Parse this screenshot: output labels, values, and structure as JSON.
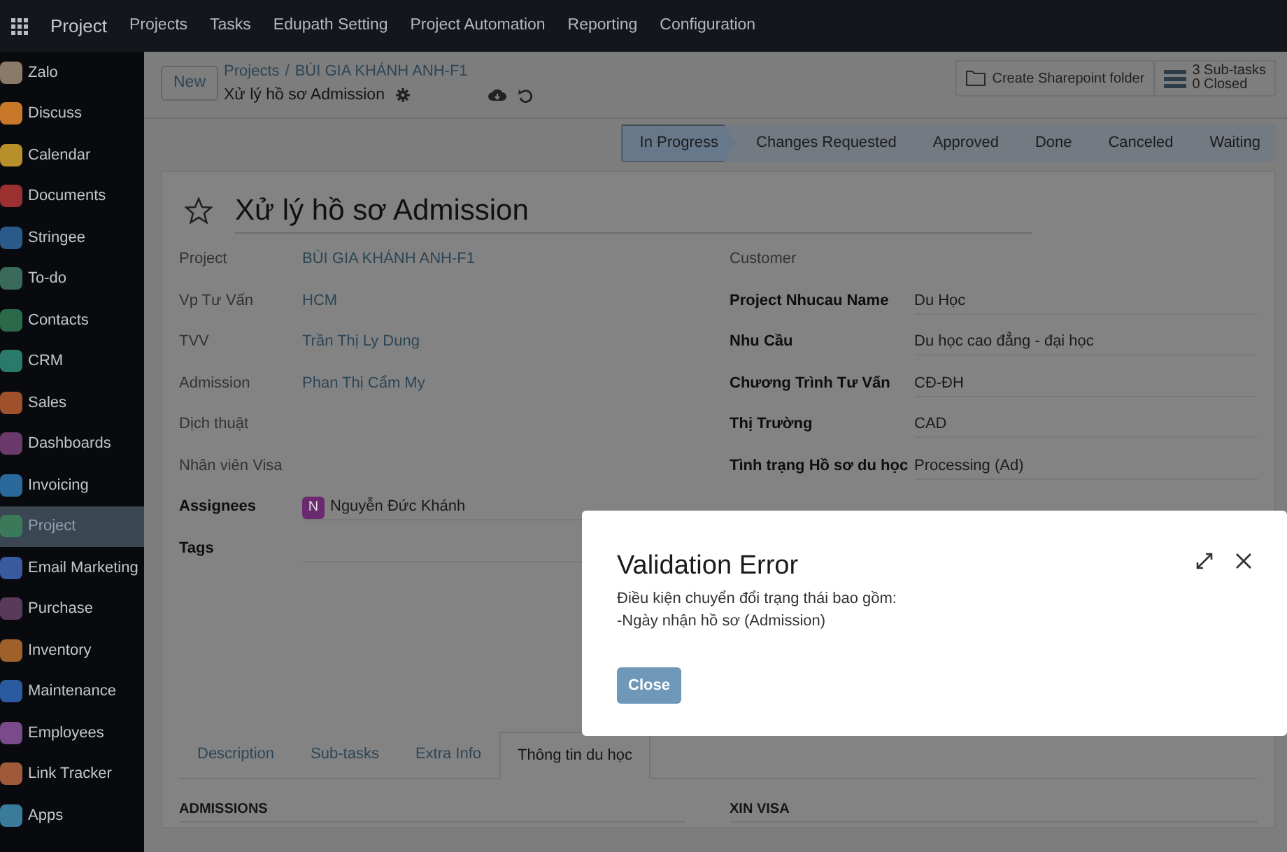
{
  "app_menu": {
    "brand": "Project",
    "items": [
      "Projects",
      "Tasks",
      "Edupath Setting",
      "Project Automation",
      "Reporting",
      "Configuration"
    ]
  },
  "sidebar": {
    "items": [
      {
        "label": "Zalo",
        "selected": false,
        "color": "#8a7a6a"
      },
      {
        "label": "Discuss",
        "selected": false,
        "color": "#c9782a"
      },
      {
        "label": "Calendar",
        "selected": false,
        "color": "#b8902a"
      },
      {
        "label": "Documents",
        "selected": false,
        "color": "#9a3030"
      },
      {
        "label": "Stringee",
        "selected": false,
        "color": "#2a5a8a"
      },
      {
        "label": "To-do",
        "selected": false,
        "color": "#3a6a5a"
      },
      {
        "label": "Contacts",
        "selected": false,
        "color": "#2a6a4a"
      },
      {
        "label": "CRM",
        "selected": false,
        "color": "#2a7a6a"
      },
      {
        "label": "Sales",
        "selected": false,
        "color": "#a0502a"
      },
      {
        "label": "Dashboards",
        "selected": false,
        "color": "#6a3a6a"
      },
      {
        "label": "Invoicing",
        "selected": false,
        "color": "#2a6a9a"
      },
      {
        "label": "Project",
        "selected": true,
        "color": "#3a7a5a"
      },
      {
        "label": "Email Marketing",
        "selected": false,
        "color": "#3a5aa0"
      },
      {
        "label": "Purchase",
        "selected": false,
        "color": "#5a3a5a"
      },
      {
        "label": "Inventory",
        "selected": false,
        "color": "#a0602a"
      },
      {
        "label": "Maintenance",
        "selected": false,
        "color": "#2a5aa0"
      },
      {
        "label": "Employees",
        "selected": false,
        "color": "#7a4a8a"
      },
      {
        "label": "Link Tracker",
        "selected": false,
        "color": "#a05a3a"
      },
      {
        "label": "Apps",
        "selected": false,
        "color": "#3a7a9a"
      }
    ]
  },
  "control_panel": {
    "new_button": "New",
    "breadcrumb": [
      "Projects",
      "BÙI GIA KHÁNH ANH-F1"
    ],
    "breadcrumb_separator": "/",
    "record_name": "Xử lý hồ sơ Admission",
    "sharepoint_button": "Create Sharepoint folder",
    "subtasks": {
      "count": "3 Sub-tasks",
      "closed": "0 Closed"
    }
  },
  "stages": [
    {
      "label": "In Progress",
      "selected": true
    },
    {
      "label": "Changes Requested",
      "selected": false
    },
    {
      "label": "Approved",
      "selected": false
    },
    {
      "label": "Done",
      "selected": false
    },
    {
      "label": "Canceled",
      "selected": false
    },
    {
      "label": "Waiting",
      "selected": false
    }
  ],
  "form": {
    "title": "Xử lý hồ sơ Admission",
    "starred": false,
    "left_fields": [
      {
        "label": "Project",
        "bold": false,
        "kind": "link",
        "value": "BÙI GIA KHÁNH ANH-F1"
      },
      {
        "label": "Vp Tư Vấn",
        "bold": false,
        "kind": "link",
        "value": "HCM"
      },
      {
        "label": "TVV",
        "bold": false,
        "kind": "link",
        "value": "Trần Thị Ly Dung"
      },
      {
        "label": "Admission",
        "bold": false,
        "kind": "link",
        "value": "Phan Thị Cẩm My"
      },
      {
        "label": "Dịch thuật",
        "bold": false,
        "kind": "empty"
      },
      {
        "label": "Nhân viên Visa",
        "bold": false,
        "kind": "empty"
      },
      {
        "label": "Assignees",
        "bold": true,
        "kind": "avatar",
        "avatar": "N",
        "color": "#6b2a70",
        "value": "Nguyễn Đức Khánh"
      },
      {
        "label": "Tags",
        "bold": true,
        "kind": "input"
      }
    ],
    "right_fields": [
      {
        "label": "Customer",
        "bold": false,
        "kind": "empty"
      },
      {
        "label": "Project Nhucau Name",
        "bold": true,
        "kind": "input",
        "value": "Du Học"
      },
      {
        "label": "Nhu Cầu",
        "bold": true,
        "kind": "input",
        "value": "Du học cao đẳng - đại học"
      },
      {
        "label": "Chương Trình Tư Vấn",
        "bold": true,
        "kind": "input",
        "value": "CĐ-ĐH"
      },
      {
        "label": "Thị Trường",
        "bold": true,
        "kind": "input",
        "value": "CAD"
      },
      {
        "label": "Tình trạng Hồ sơ du học",
        "bold": true,
        "kind": "input",
        "value": "Processing (Ad)"
      }
    ],
    "tabs": [
      {
        "label": "Description",
        "selected": false
      },
      {
        "label": "Sub-tasks",
        "selected": false
      },
      {
        "label": "Extra Info",
        "selected": false
      },
      {
        "label": "Thông tin du học",
        "selected": true
      }
    ],
    "sections": [
      "ADMISSIONS",
      "XIN VISA"
    ]
  },
  "dialog": {
    "title": "Validation Error",
    "lines": [
      "Điều kiện chuyển đổi trạng thái bao gồm:",
      "-Ngày nhận hồ sơ (Admission)"
    ],
    "button": "Close"
  }
}
